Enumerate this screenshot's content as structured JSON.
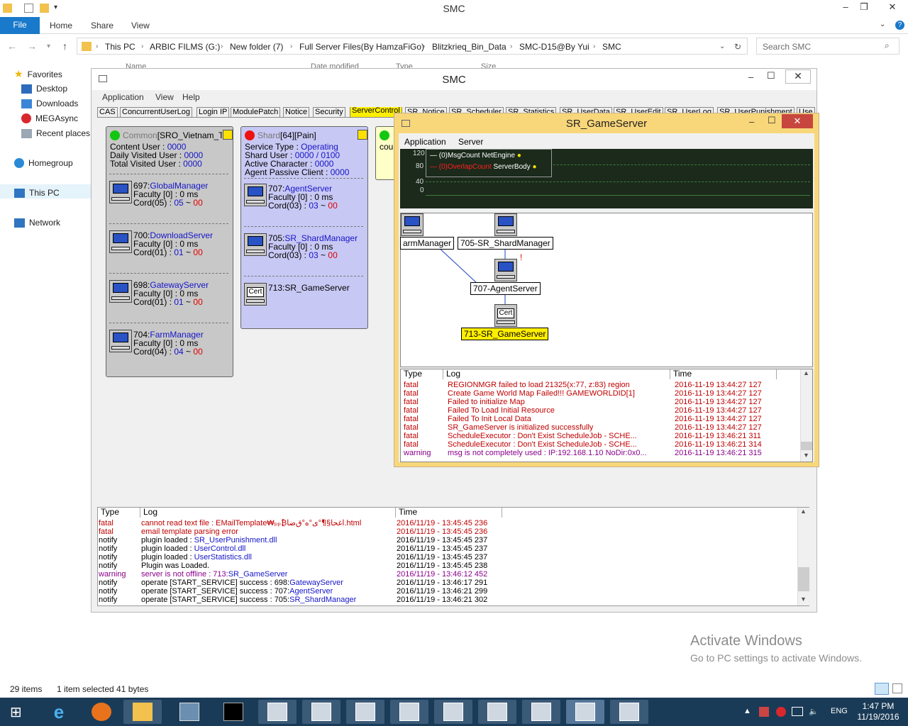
{
  "explorer": {
    "title": "SMC",
    "tabs": {
      "file": "File",
      "home": "Home",
      "share": "Share",
      "view": "View"
    },
    "breadcrumb": [
      "This PC",
      "ARBIC FILMS (G:)",
      "New folder (7)",
      "Full Server Files(By HamzaFiGo)",
      "Blitzkrieq_Bin_Data",
      "SMC-D15@By Yui",
      "SMC"
    ],
    "search_placeholder": "Search SMC",
    "nav": {
      "favorites": "Favorites",
      "desktop": "Desktop",
      "downloads": "Downloads",
      "megasync": "MEGAsync",
      "recent": "Recent places",
      "homegroup": "Homegroup",
      "thispc": "This PC",
      "network": "Network"
    },
    "columns": {
      "name": "Name",
      "date": "Date modified",
      "type": "Type",
      "size": "Size"
    },
    "status": {
      "items": "29 items",
      "selected": "1 item selected  41 bytes"
    }
  },
  "watermark": {
    "line1": "Activate Windows",
    "line2": "Go to PC settings to activate Windows."
  },
  "taskbar": {
    "lang": "ENG",
    "time": "1:47 PM",
    "date": "11/19/2016"
  },
  "smc": {
    "title": "SMC",
    "menu": {
      "application": "Application",
      "view": "View",
      "help": "Help"
    },
    "tabs": [
      "CAS",
      "ConcurrentUserLog",
      "Login IP",
      "ModulePatch",
      "Notice",
      "Security",
      "ServerControl",
      "SR_Notice",
      "SR_Scheduler",
      "SR_Statistics",
      "SR_UserData",
      "SR_UserEdit",
      "SR_UserLog",
      "SR_UserPunishment",
      "Use"
    ],
    "common": {
      "header_a": "Common",
      "header_b": "[SRO_Vietnam_TestL",
      "content_user_label": "Content User : ",
      "content_user": "0000",
      "daily_label": "Daily Visited User : ",
      "daily": "0000",
      "total_label": "Total Visited User : ",
      "total": "0000",
      "servers": [
        {
          "id": "697:",
          "name": "GlobalManager",
          "faculty": "Faculty [0] : 0 ms",
          "cord_a": "Cord(05) : ",
          "cord_b": "05",
          "cord_c": " ~ ",
          "cord_d": "00"
        },
        {
          "id": "700:",
          "name": "DownloadServer",
          "faculty": "Faculty [0] : 0 ms",
          "cord_a": "Cord(01) : ",
          "cord_b": "01",
          "cord_c": " ~ ",
          "cord_d": "00"
        },
        {
          "id": "698:",
          "name": "GatewayServer",
          "faculty": "Faculty [0] : 0 ms",
          "cord_a": "Cord(01) : ",
          "cord_b": "01",
          "cord_c": " ~ ",
          "cord_d": "00"
        },
        {
          "id": "704:",
          "name": "FarmManager",
          "faculty": "Faculty [0] : 0 ms",
          "cord_a": "Cord(04) : ",
          "cord_b": "04",
          "cord_c": " ~ ",
          "cord_d": "00"
        }
      ]
    },
    "shard": {
      "header_a": "Shard",
      "header_b": "[64][Pain]",
      "service_label": "Service Type : ",
      "service": "Operating",
      "shard_user_label": "Shard User : ",
      "shard_user": "0000 / 0100",
      "active_label": "Active Character : ",
      "active": "0000",
      "agent_label": "Agent Passive Client : ",
      "agent": "0000",
      "servers": [
        {
          "id": "707:",
          "name": "AgentServer",
          "faculty": "Faculty [0] : 0 ms",
          "cord_a": "Cord(03) : ",
          "cord_b": "03",
          "cord_c": " ~ ",
          "cord_d": "00"
        },
        {
          "id": "705:",
          "name": "SR_ShardManager",
          "faculty": "Faculty [0] : 0 ms",
          "cord_a": "Cord(03) : ",
          "cord_b": "03",
          "cord_c": " ~ ",
          "cord_d": "00"
        }
      ],
      "cert_label": "Cert",
      "cert_server": "713:SR_GameServer"
    },
    "third_panel_text": "cou",
    "log": {
      "headers": {
        "type": "Type",
        "log": "Log",
        "time": "Time"
      },
      "rows": [
        {
          "type": "fatal",
          "msg": "cannot read text file : EMailTemplate₩ₚₚ₿اغحا§¶ْ°ی°ە°ق‌ضا.html",
          "link": "",
          "time": "2016/11/19 - 13:45:45 236",
          "color": "#c00000"
        },
        {
          "type": "fatal",
          "msg": "email template parsing error",
          "link": "",
          "time": "2016/11/19 - 13:45:45 236",
          "color": "#c00000"
        },
        {
          "type": "notify",
          "msg": "plugin loaded : ",
          "link": "SR_UserPunishment.dll",
          "time": "2016/11/19 - 13:45:45 237",
          "color": "#000000"
        },
        {
          "type": "notify",
          "msg": "plugin loaded : ",
          "link": "UserControl.dll",
          "time": "2016/11/19 - 13:45:45 237",
          "color": "#000000"
        },
        {
          "type": "notify",
          "msg": "plugin loaded : ",
          "link": "UserStatistics.dll",
          "time": "2016/11/19 - 13:45:45 237",
          "color": "#000000"
        },
        {
          "type": "notify",
          "msg": "Plugin was Loaded.",
          "link": "",
          "time": "2016/11/19 - 13:45:45 238",
          "color": "#000000"
        },
        {
          "type": "warning",
          "msg": "server is not offline : 713:",
          "link": "SR_GameServer",
          "time": "2016/11/19 - 13:46:12 452",
          "color": "#8a008a"
        },
        {
          "type": "notify",
          "msg": "operate [START_SERVICE] success : 698:",
          "link": "GatewayServer",
          "time": "2016/11/19 - 13:46:17 291",
          "color": "#000000"
        },
        {
          "type": "notify",
          "msg": "operate [START_SERVICE] success : 707:",
          "link": "AgentServer",
          "time": "2016/11/19 - 13:46:21 299",
          "color": "#000000"
        },
        {
          "type": "notify",
          "msg": "operate [START_SERVICE] success : 705:",
          "link": "SR_ShardManager",
          "time": "2016/11/19 - 13:46:21 302",
          "color": "#000000"
        }
      ]
    }
  },
  "gameserver": {
    "title": "SR_GameServer",
    "menu": {
      "application": "Application",
      "server": "Server"
    },
    "chart": {
      "y_ticks": [
        "120",
        "80",
        "40",
        "0"
      ],
      "legend": [
        {
          "prefix": "— (0)",
          "name": "MsgCount",
          "suffix": " NetEngine",
          "color": "#ffffff"
        },
        {
          "prefix": "— (0)",
          "name": "OverlapCount",
          "suffix": " ServerBody",
          "color": "#ff2020"
        }
      ]
    },
    "diagram": {
      "node_left": "armManager",
      "node_shard": "705-SR_ShardManager",
      "node_agent": "707-AgentServer",
      "node_game": "713-SR_GameServer",
      "cert": "Cert"
    },
    "log": {
      "headers": {
        "type": "Type",
        "log": "Log",
        "time": "Time"
      },
      "rows": [
        {
          "type": "fatal",
          "msg": "REGIONMGR failed to load 21325(x:77, z:83) region",
          "time": "2016-11-19 13:44:27 127",
          "color": "#c00000"
        },
        {
          "type": "fatal",
          "msg": "Create Game World Map Failed!!! GAMEWORLDID[1]",
          "time": "2016-11-19 13:44:27 127",
          "color": "#c00000"
        },
        {
          "type": "fatal",
          "msg": "Failed to initialize Map",
          "time": "2016-11-19 13:44:27 127",
          "color": "#c00000"
        },
        {
          "type": "fatal",
          "msg": "Failed To Load Initial Resource",
          "time": "2016-11-19 13:44:27 127",
          "color": "#c00000"
        },
        {
          "type": "fatal",
          "msg": "Failed To Init Local Data",
          "time": "2016-11-19 13:44:27 127",
          "color": "#c00000"
        },
        {
          "type": "fatal",
          "msg": "SR_GameServer is initialized successfully",
          "time": "2016-11-19 13:44:27 127",
          "color": "#c00000"
        },
        {
          "type": "fatal",
          "msg": "ScheduleExecutor : Don't Exist ScheduleJob - SCHE...",
          "time": "2016-11-19 13:46:21 311",
          "color": "#c00000"
        },
        {
          "type": "fatal",
          "msg": "ScheduleExecutor : Don't Exist ScheduleJob - SCHE...",
          "time": "2016-11-19 13:46:21 314",
          "color": "#c00000"
        },
        {
          "type": "warning",
          "msg": "msg is not completely used : IP:192.168.1.10 NoDir:0x0...",
          "time": "2016-11-19 13:46:21 315",
          "color": "#8a008a"
        }
      ]
    }
  }
}
